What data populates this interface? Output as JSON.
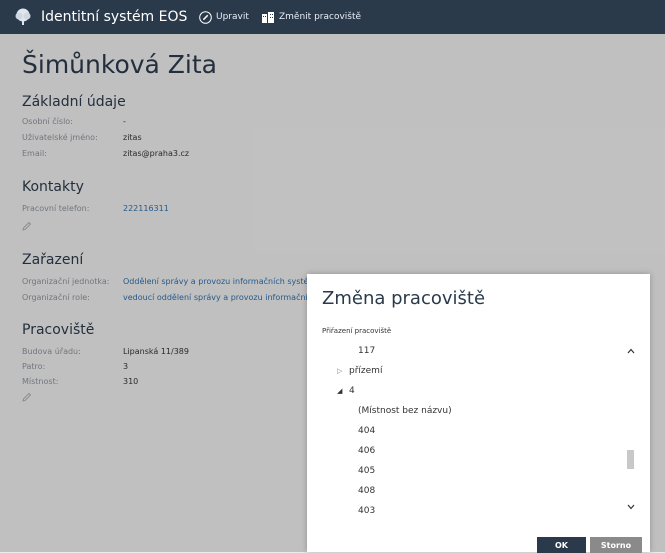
{
  "app": {
    "title": "Identitní systém EOS"
  },
  "toolbar": {
    "edit_label": "Upravit",
    "change_workplace_label": "Změnit pracoviště"
  },
  "person": {
    "name": "Šimůnková Zita"
  },
  "basic": {
    "title": "Základní údaje",
    "rows": [
      {
        "label": "Osobní číslo:",
        "value": "-"
      },
      {
        "label": "Uživatelské jméno:",
        "value": "zitas"
      },
      {
        "label": "Email:",
        "value": "zitas@praha3.cz"
      }
    ]
  },
  "contacts": {
    "title": "Kontakty",
    "rows": [
      {
        "label": "Pracovní telefon:",
        "value": "222116311"
      }
    ]
  },
  "assignment": {
    "title": "Zařazení",
    "rows": [
      {
        "label": "Organizační jednotka:",
        "value": "Oddělení správy a provozu informačních systémů"
      },
      {
        "label": "Organizační role:",
        "value": "vedoucí oddělení správy a provozu informačních s"
      }
    ]
  },
  "workplace": {
    "title": "Pracoviště",
    "rows": [
      {
        "label": "Budova úřadu:",
        "value": "Lipanská 11/389"
      },
      {
        "label": "Patro:",
        "value": "3"
      },
      {
        "label": "Místnost:",
        "value": "310"
      }
    ]
  },
  "dialog": {
    "title": "Změna pracoviště",
    "field_label": "Přiřazení pracoviště",
    "tree": [
      {
        "text": "117",
        "arrow": ""
      },
      {
        "text": "přízemí",
        "arrow": "▷"
      },
      {
        "text": "4",
        "arrow": "◢"
      },
      {
        "text": "(Místnost bez názvu)",
        "arrow": ""
      },
      {
        "text": "404",
        "arrow": ""
      },
      {
        "text": "406",
        "arrow": ""
      },
      {
        "text": "405",
        "arrow": ""
      },
      {
        "text": "408",
        "arrow": ""
      },
      {
        "text": "403",
        "arrow": ""
      }
    ],
    "ok_label": "OK",
    "cancel_label": "Storno"
  },
  "colors": {
    "topbar": "#2b3a4b",
    "link": "#2f6ea8",
    "cancel": "#8a8a8a"
  }
}
